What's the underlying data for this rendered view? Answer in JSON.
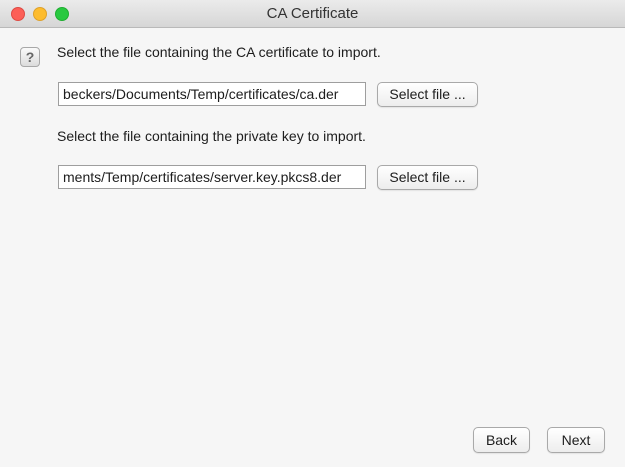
{
  "window": {
    "title": "CA Certificate"
  },
  "cert": {
    "prompt": "Select the file containing the CA certificate to import.",
    "path": "beckers/Documents/Temp/certificates/ca.der",
    "select_label": "Select file ..."
  },
  "key": {
    "prompt": "Select the file containing the private key to import.",
    "path": "ments/Temp/certificates/server.key.pkcs8.der",
    "select_label": "Select file ..."
  },
  "footer": {
    "back_label": "Back",
    "next_label": "Next"
  },
  "icons": {
    "help": "question-icon",
    "help_glyph": "?"
  }
}
